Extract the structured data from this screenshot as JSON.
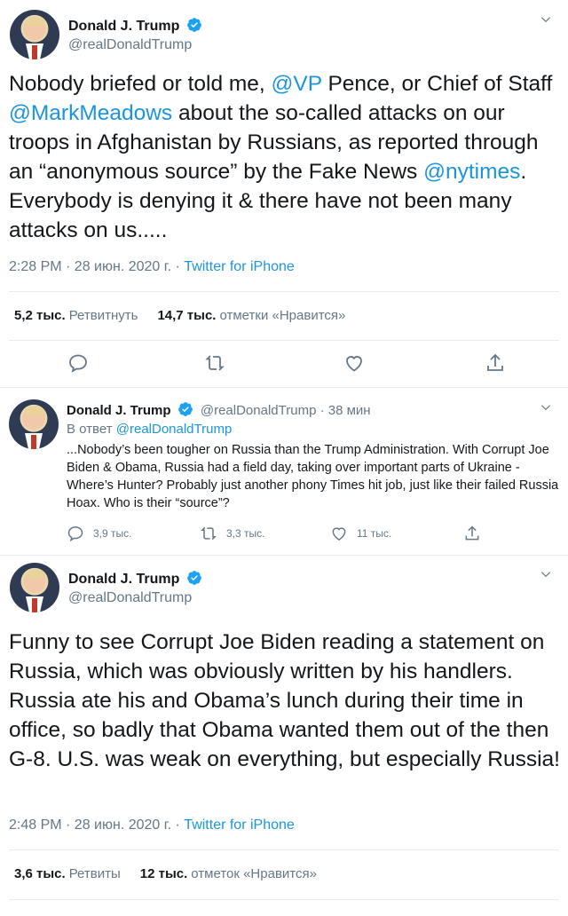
{
  "tweet1": {
    "author_name": "Donald J. Trump",
    "author_handle": "@realDonaldTrump",
    "text_before_1": "Nobody briefed or told me, ",
    "mention_1": "@VP",
    "text_before_2": " Pence, or Chief of Staff ",
    "mention_2": "@MarkMeadows",
    "text_before_3": " about the so-called attacks on our troops in Afghanistan by Russians, as reported through an “anonymous source” by the Fake News ",
    "mention_3": "@nytimes",
    "text_after": ". Everybody is denying it & there have not been many attacks on us.....",
    "time": "2:28 PM · 28 июн. 2020 г. · ",
    "source": "Twitter for iPhone",
    "retweets_count": "5,2 тыс.",
    "retweets_label": "Ретвитнуть",
    "likes_count": "14,7 тыс.",
    "likes_label": "отметки «Нравится»"
  },
  "reply": {
    "author_name": "Donald J. Trump",
    "meta": "@realDonaldTrump · 38 мин",
    "in_reply_prefix": "В ответ ",
    "in_reply_handle": "@realDonaldTrump",
    "text": "...Nobody’s been tougher on Russia than the Trump Administration. With Corrupt Joe Biden & Obama, Russia had a field day, taking over important parts of Ukraine - Where’s Hunter? Probably just another phony Times hit job, just like their failed Russia Hoax. Who is their “source”?",
    "replies": "3,9 тыс.",
    "retweets": "3,3 тыс.",
    "likes": "11 тыс."
  },
  "tweet3": {
    "author_name": "Donald J. Trump",
    "author_handle": "@realDonaldTrump",
    "text": "Funny to see Corrupt Joe Biden reading a statement on Russia, which was obviously written by his handlers. Russia ate his and Obama’s lunch during their time in office, so badly that Obama wanted them out of the then G-8. U.S. was weak on everything, but especially Russia!",
    "time": "2:48 PM · 28 июн. 2020 г. · ",
    "source": "Twitter for iPhone",
    "retweets_count": "3,6 тыс.",
    "retweets_label": "Ретвиты",
    "likes_count": "12 тыс.",
    "likes_label": "отметок «Нравится»"
  },
  "icons": {
    "verified": "verified-badge-icon",
    "chevron": "chevron-down-icon",
    "reply": "reply-icon",
    "retweet": "retweet-icon",
    "like": "heart-icon",
    "share": "share-icon"
  },
  "colors": {
    "accent": "#1b95e0",
    "muted": "#657786",
    "text": "#14171a",
    "divider": "#e6ecf0"
  }
}
